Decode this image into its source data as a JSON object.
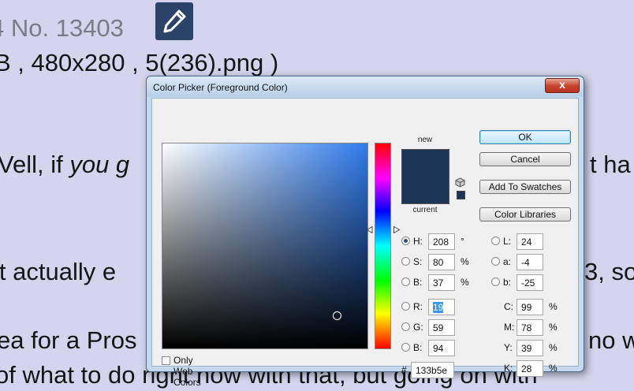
{
  "background": {
    "line1": "4 No. 13403",
    "line2": "B , 480x280 , 5(236).png )",
    "line3_a": "Vell, if ",
    "line3_b": "you g",
    "line3_right": "t ha",
    "line4": "'t actually e",
    "line4_right": "3, so",
    "line5": "ea for a Pros",
    "line5_right": "no w",
    "line6": "of what to do right now with that, but going on with"
  },
  "dialog": {
    "title": "Color Picker (Foreground Color)",
    "close_label": "x",
    "new_label": "new",
    "current_label": "current",
    "buttons": {
      "ok": "OK",
      "cancel": "Cancel",
      "add_to_swatches": "Add To Swatches",
      "color_libraries": "Color Libraries"
    },
    "hsb": [
      {
        "label": "H:",
        "value": "208",
        "unit": "°"
      },
      {
        "label": "S:",
        "value": "80",
        "unit": "%"
      },
      {
        "label": "B:",
        "value": "37",
        "unit": "%"
      }
    ],
    "rgb": [
      {
        "label": "R:",
        "value": "19"
      },
      {
        "label": "G:",
        "value": "59"
      },
      {
        "label": "B:",
        "value": "94"
      }
    ],
    "lab": [
      {
        "label": "L:",
        "value": "24"
      },
      {
        "label": "a:",
        "value": "-4"
      },
      {
        "label": "b:",
        "value": "-25"
      }
    ],
    "cmyk": [
      {
        "label": "C:",
        "value": "99",
        "unit": "%"
      },
      {
        "label": "M:",
        "value": "78",
        "unit": "%"
      },
      {
        "label": "Y:",
        "value": "39",
        "unit": "%"
      },
      {
        "label": "K:",
        "value": "28",
        "unit": "%"
      }
    ],
    "hash": "#",
    "hex": "133b5e",
    "only_web_colors": "Only Web Colors",
    "selected_radio": "H",
    "colors": {
      "new_swatch": "#1c3556",
      "field_hue": "#2f7bed",
      "close": "#c4412c"
    }
  }
}
